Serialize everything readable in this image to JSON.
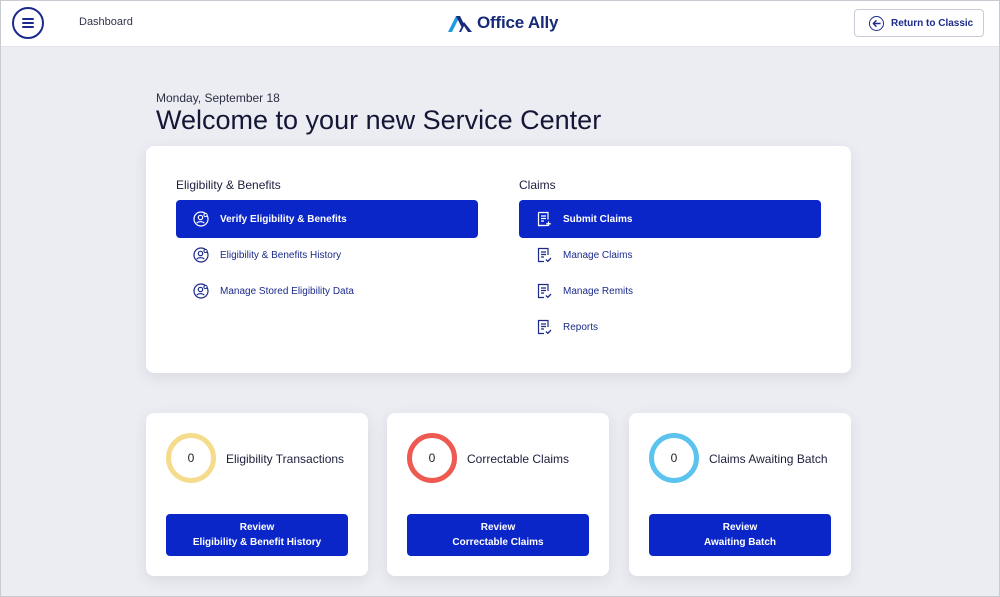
{
  "header": {
    "breadcrumb": "Dashboard",
    "logo_text": "Office Ally",
    "return_label": "Return to Classic"
  },
  "welcome": {
    "date": "Monday, September 18",
    "title": "Welcome to your new Service Center"
  },
  "eligibility": {
    "title": "Eligibility & Benefits",
    "items": [
      {
        "label": "Verify Eligibility & Benefits",
        "icon": "user-search-icon",
        "active": true
      },
      {
        "label": "Eligibility & Benefits History",
        "icon": "user-search-icon",
        "active": false
      },
      {
        "label": "Manage Stored Eligibility Data",
        "icon": "user-search-icon",
        "active": false
      }
    ]
  },
  "claims": {
    "title": "Claims",
    "items": [
      {
        "label": "Submit Claims",
        "icon": "document-plus-icon",
        "active": true
      },
      {
        "label": "Manage Claims",
        "icon": "document-check-icon",
        "active": false
      },
      {
        "label": "Manage Remits",
        "icon": "document-check-icon",
        "active": false
      },
      {
        "label": "Reports",
        "icon": "document-check-icon",
        "active": false
      }
    ]
  },
  "stats": [
    {
      "count": "0",
      "label": "Eligibility Transactions",
      "ring_color": "#f5dc8c",
      "button_line1": "Review",
      "button_line2": "Eligibility & Benefit History"
    },
    {
      "count": "0",
      "label": "Correctable Claims",
      "ring_color": "#ee5a52",
      "button_line1": "Review",
      "button_line2": "Correctable Claims"
    },
    {
      "count": "0",
      "label": "Claims Awaiting Batch",
      "ring_color": "#5cc3ef",
      "button_line1": "Review",
      "button_line2": "Awaiting Batch"
    }
  ],
  "colors": {
    "primary": "#0a26c9",
    "navy": "#1b2a8c",
    "background": "#ecedf3"
  }
}
